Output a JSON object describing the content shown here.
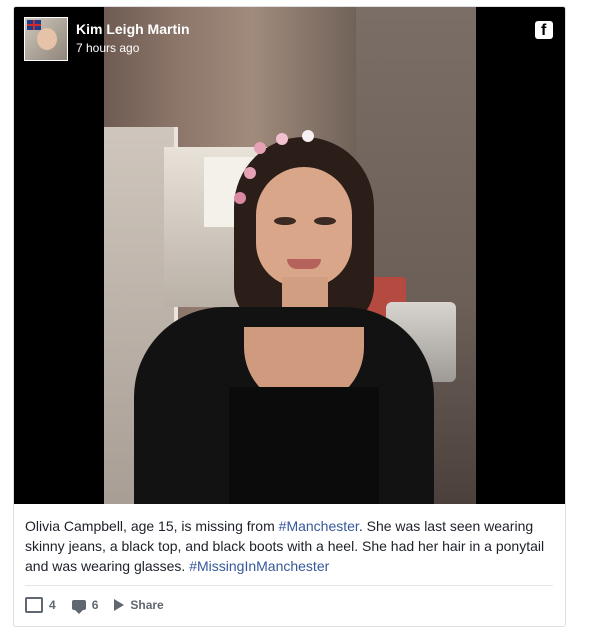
{
  "post": {
    "author": "Kim Leigh Martin",
    "timestamp": "7 hours ago",
    "platform_icon": "facebook-icon",
    "caption": {
      "parts": [
        "Olivia Campbell, age 15, is missing from ",
        "#Manchester",
        ". She was last seen wearing skinny jeans, a black top, and black boots with a heel. She had her hair in a ponytail and was wearing glasses. ",
        "#MissingInManchester"
      ]
    },
    "actions": {
      "likes": "4",
      "comments": "6",
      "share_label": "Share"
    }
  }
}
